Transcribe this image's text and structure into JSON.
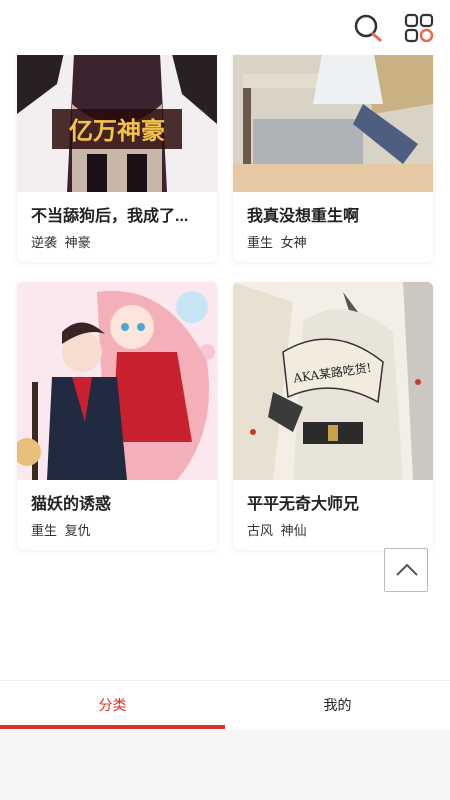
{
  "header": {
    "search_icon": "search-icon",
    "menu_icon": "grid-menu-icon",
    "accent": "#e8674e"
  },
  "comics": [
    {
      "title": "不当舔狗后，我成了...",
      "tags": [
        "逆袭",
        "神豪"
      ],
      "cover_text": "亿万神豪"
    },
    {
      "title": "我真没想重生啊",
      "tags": [
        "重生",
        "女神"
      ]
    },
    {
      "title": "猫妖的诱惑",
      "tags": [
        "重生",
        "复仇"
      ]
    },
    {
      "title": "平平无奇大师兄",
      "tags": [
        "古风",
        "神仙"
      ],
      "cover_text": "AKA某路吃货!"
    }
  ],
  "back_to_top_icon": "chevron-up-icon",
  "tabs": [
    {
      "label": "分类",
      "active": true
    },
    {
      "label": "我的",
      "active": false
    }
  ],
  "colors": {
    "active_tab": "#d8322a"
  }
}
